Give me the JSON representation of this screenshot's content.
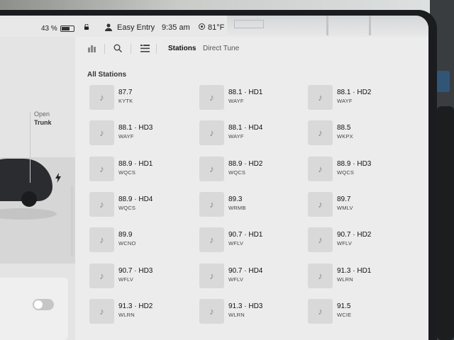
{
  "status": {
    "battery_percent": "43 %",
    "profile": "Easy Entry",
    "time": "9:35 am",
    "temperature": "81°F",
    "icons": [
      "battery-icon",
      "lock-icon",
      "user-icon",
      "thermometer-icon"
    ]
  },
  "car": {
    "open_label": "Open",
    "trunk_label": "Trunk",
    "charge_icon": "bolt-icon",
    "toggle_on": false
  },
  "toolbar": {
    "icons": [
      "library-icon",
      "search-icon",
      "menu-icon"
    ],
    "tabs": [
      {
        "label": "Stations",
        "active": true
      },
      {
        "label": "Direct Tune",
        "active": false
      }
    ]
  },
  "section_title": "All Stations",
  "stations": [
    {
      "freq": "87.7",
      "call": "KYTK"
    },
    {
      "freq": "88.1 · HD1",
      "call": "WAYF"
    },
    {
      "freq": "88.1 · HD2",
      "call": "WAYF"
    },
    {
      "freq": "88.1 · HD3",
      "call": "WAYF"
    },
    {
      "freq": "88.1 · HD4",
      "call": "WAYF"
    },
    {
      "freq": "88.5",
      "call": "WKPX"
    },
    {
      "freq": "88.9 · HD1",
      "call": "WQCS"
    },
    {
      "freq": "88.9 · HD2",
      "call": "WQCS"
    },
    {
      "freq": "88.9 · HD3",
      "call": "WQCS"
    },
    {
      "freq": "88.9 · HD4",
      "call": "WQCS"
    },
    {
      "freq": "89.3",
      "call": "WRMB"
    },
    {
      "freq": "89.7",
      "call": "WMLV"
    },
    {
      "freq": "89.9",
      "call": "WCNO"
    },
    {
      "freq": "90.7 · HD1",
      "call": "WFLV"
    },
    {
      "freq": "90.7 · HD2",
      "call": "WFLV"
    },
    {
      "freq": "90.7 · HD3",
      "call": "WFLV"
    },
    {
      "freq": "90.7 · HD4",
      "call": "WFLV"
    },
    {
      "freq": "91.3 · HD1",
      "call": "WLRN"
    },
    {
      "freq": "91.3 · HD2",
      "call": "WLRN"
    },
    {
      "freq": "91.3 · HD3",
      "call": "WLRN"
    },
    {
      "freq": "91.5",
      "call": "WCIE"
    }
  ],
  "station_icon": "music-note-icon"
}
